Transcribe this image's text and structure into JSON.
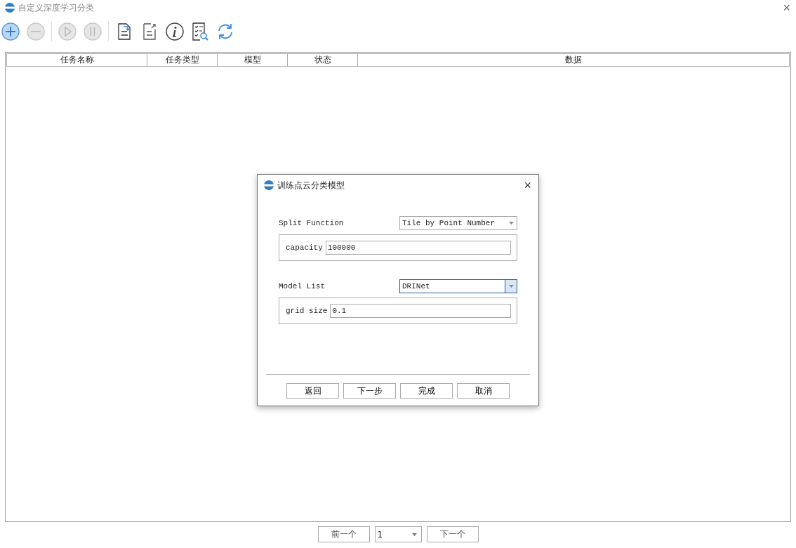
{
  "window": {
    "title": "自定义深度学习分类",
    "close": "×"
  },
  "toolbar": [
    {
      "kind": "add",
      "disabled": false
    },
    {
      "kind": "remove",
      "disabled": true
    },
    {
      "kind": "play",
      "disabled": true
    },
    {
      "kind": "pause",
      "disabled": true
    },
    {
      "kind": "import",
      "disabled": false
    },
    {
      "kind": "export",
      "disabled": false
    },
    {
      "kind": "info",
      "disabled": false
    },
    {
      "kind": "checklist",
      "disabled": false
    },
    {
      "kind": "refresh",
      "disabled": false
    }
  ],
  "table": {
    "columns": [
      "任务名称",
      "任务类型",
      "模型",
      "状态",
      "数据"
    ]
  },
  "pager": {
    "prev": "前一个",
    "page": "1",
    "next": "下一个"
  },
  "dialog": {
    "title": "训练点云分类模型",
    "close": "×",
    "sections": [
      {
        "label": "Split Function",
        "value": "Tile by Point Number",
        "focused": false,
        "param_label": "capacity",
        "param_value": "100000"
      },
      {
        "label": "Model List",
        "value": "DRINet",
        "focused": true,
        "param_label": "grid size",
        "param_value": "0.1"
      }
    ],
    "buttons": [
      "返回",
      "下一步",
      "完成",
      "取消"
    ]
  }
}
